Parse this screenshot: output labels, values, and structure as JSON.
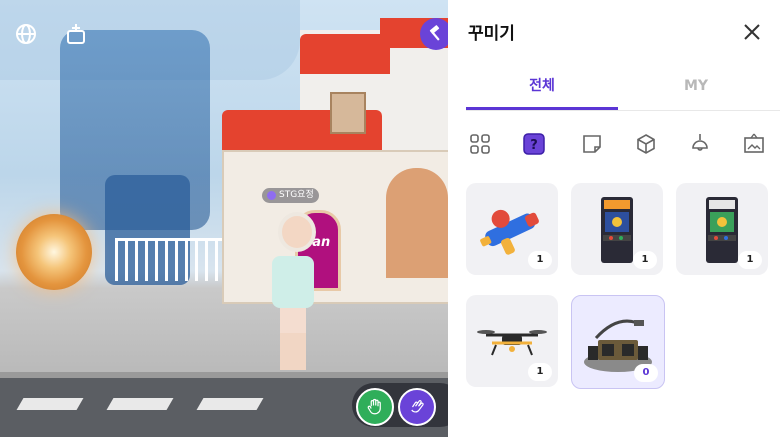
{
  "scene": {
    "nametag": "STG요정",
    "brand_sign": "flan",
    "hud_left_icons": [
      "globe-icon",
      "add-photo-icon"
    ],
    "hud_right_icon": "hammer-icon",
    "emote_icons": [
      "hand-palm-icon",
      "hand-wave-icon"
    ],
    "colors": {
      "accent": "#6a43d8",
      "roof": "#e4432f",
      "emote_green": "#2fae5a",
      "emote_purple": "#6a43d8"
    }
  },
  "panel": {
    "title": "꾸미기",
    "close_icon": "close-icon",
    "tabs": [
      {
        "label": "전체",
        "active": true
      },
      {
        "label": "MY",
        "active": false
      }
    ],
    "categories": [
      {
        "icon": "grid-icon",
        "active": false
      },
      {
        "icon": "mystery-box-icon",
        "active": true
      },
      {
        "icon": "sticker-icon",
        "active": false
      },
      {
        "icon": "cube-icon",
        "active": false
      },
      {
        "icon": "lamp-icon",
        "active": false
      },
      {
        "icon": "picture-frame-icon",
        "active": false
      }
    ],
    "items": [
      {
        "name": "water-gun",
        "count": "1",
        "selected": false
      },
      {
        "name": "arcade-machine-orange",
        "count": "1",
        "selected": false
      },
      {
        "name": "arcade-machine-green",
        "count": "1",
        "selected": false
      },
      {
        "name": "drone",
        "count": "1",
        "selected": false
      },
      {
        "name": "dj-booth",
        "count": "0",
        "selected": true
      }
    ],
    "colors": {
      "accent": "#5b35d5",
      "inactive_tab": "#b8b8b8",
      "cell_bg": "#f1f1f4",
      "selected_bg": "#ecebff"
    }
  }
}
